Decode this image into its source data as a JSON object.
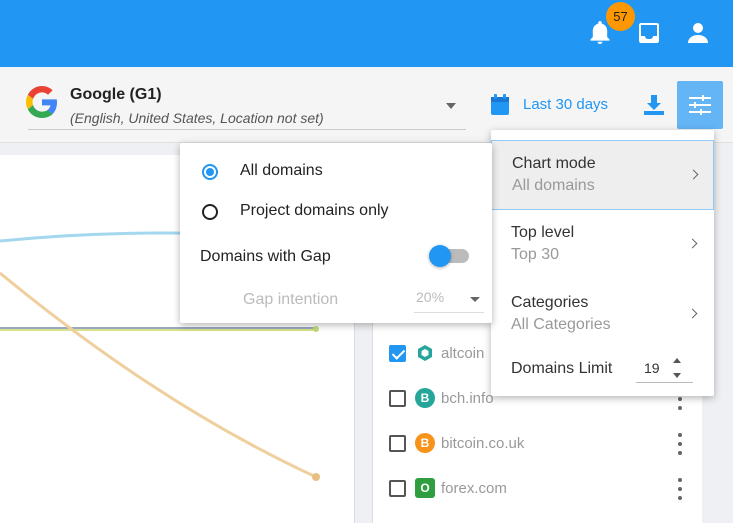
{
  "topbar": {
    "notifications_count": "57",
    "icons": [
      "bell-icon",
      "inbox-icon",
      "user-icon"
    ],
    "color": "#2196f3"
  },
  "engine": {
    "name": "Google (G1)",
    "details": "(English, United States, Location not set)"
  },
  "toolbar": {
    "date_range": "Last 30 days"
  },
  "menu": {
    "chart_mode": {
      "title": "Chart mode",
      "value": "All domains"
    },
    "top_level": {
      "title": "Top level",
      "value": "Top 30"
    },
    "categories": {
      "title": "Categories",
      "value": "All Categories"
    },
    "domains_limit": {
      "title": "Domains Limit",
      "value": "19"
    }
  },
  "popup": {
    "option_all": "All domains",
    "option_project": "Project domains only",
    "selected": "All domains",
    "gap_label": "Domains with Gap",
    "gap_enabled": true,
    "gap_intention_label": "Gap intention",
    "gap_intention_value": "20%"
  },
  "domains": [
    {
      "name": "altcoin",
      "checked": true,
      "color": "#26a69a",
      "letter": ""
    },
    {
      "name": "bch.info",
      "checked": false,
      "color": "#26a69a",
      "letter": "B"
    },
    {
      "name": "bitcoin.co.uk",
      "checked": false,
      "color": "#f7931a",
      "letter": "B"
    },
    {
      "name": "forex.com",
      "checked": false,
      "color": "#2e9e3e",
      "letter": "O"
    }
  ]
}
